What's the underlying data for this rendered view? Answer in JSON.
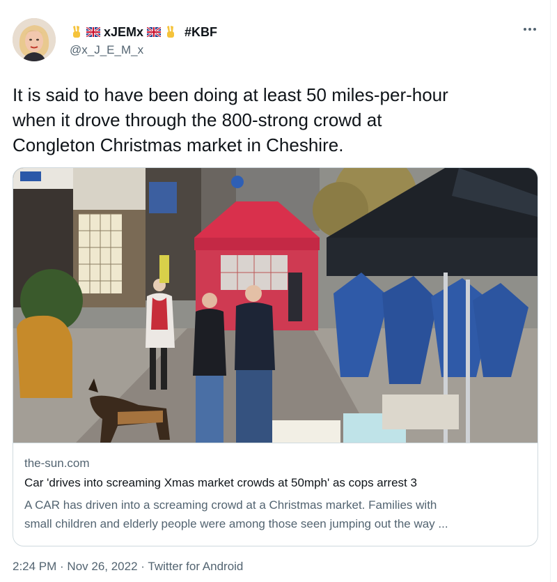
{
  "author": {
    "display_name_text": "xJEMx",
    "hashtag": "#KBF",
    "handle": "@x_J_E_M_x",
    "avatar_icon": "profile-photo-icon",
    "name_icons": [
      "victory-hand-icon",
      "uk-flag-icon",
      "uk-flag-icon",
      "victory-hand-icon"
    ]
  },
  "more_icon": "more-dots-icon",
  "tweet": {
    "lines": [
      "It is said to have been doing at least 50 miles-per-hour",
      "when it drove through the 800-strong crowd at",
      "Congleton Christmas market in Cheshire."
    ]
  },
  "card": {
    "image_icon": "street-market-photo",
    "domain": "the-sun.com",
    "title": "Car 'drives into screaming Xmas market crowds at 50mph' as cops arrest 3",
    "description_lines": [
      "A CAR has driven into a screaming crowd at a Christmas market. Families with",
      "small children and elderly people were among those seen jumping out the way ..."
    ]
  },
  "meta": {
    "time": "2:24 PM",
    "sep1": " · ",
    "date": "Nov 26, 2022",
    "sep2": " · ",
    "source": "Twitter for Android"
  },
  "colors": {
    "text": "#0f1419",
    "secondary": "#536471",
    "border": "#cfd9de",
    "tent_red": "#d9304c",
    "umbrella_blue": "#2f5aa8",
    "canopy_black": "#1e2228"
  }
}
